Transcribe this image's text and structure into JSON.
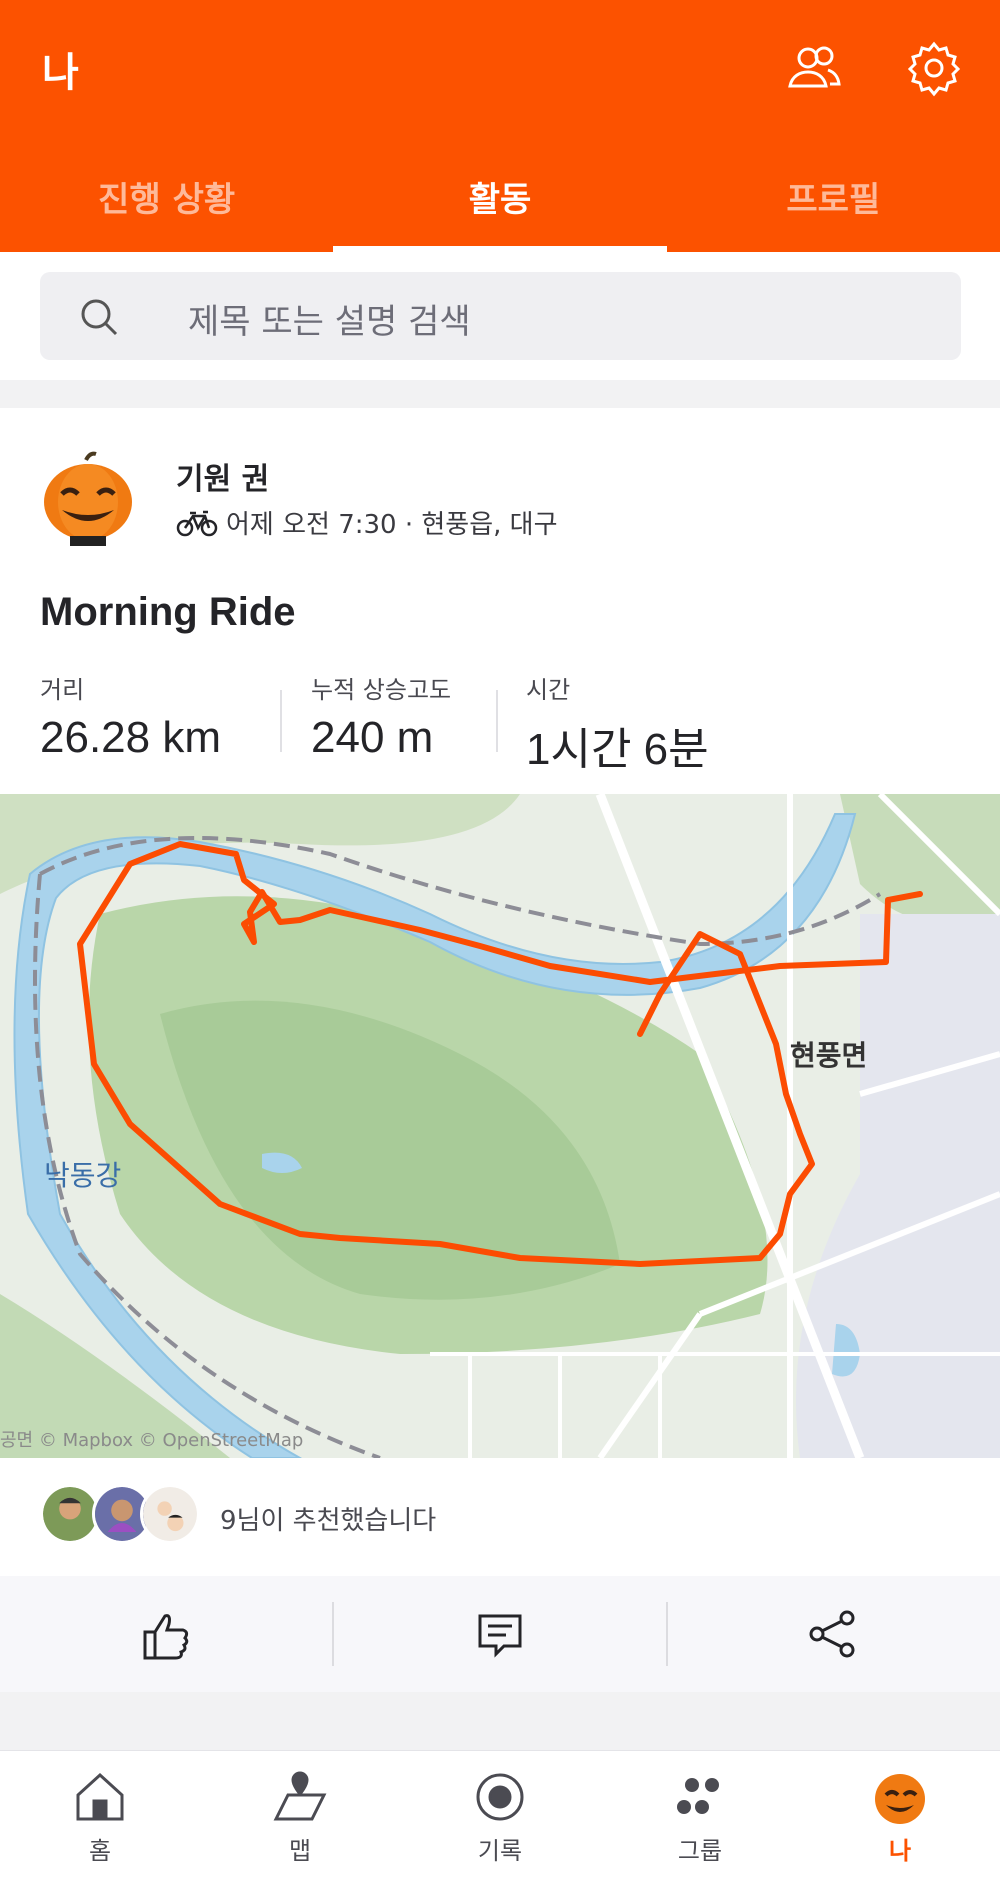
{
  "header": {
    "title": "나",
    "tabs": [
      {
        "label": "진행 상황"
      },
      {
        "label": "활동"
      },
      {
        "label": "프로필"
      }
    ]
  },
  "search": {
    "placeholder": "제목 또는 설명 검색"
  },
  "activity": {
    "athlete_name": "기원 권",
    "meta": "어제 오전 7:30 · 현풍읍, 대구",
    "title": "Morning Ride",
    "stats": [
      {
        "label": "거리",
        "value": "26.28 km"
      },
      {
        "label": "누적 상승고도",
        "value": "240 m"
      },
      {
        "label": "시간",
        "value": "1시간 6분"
      }
    ],
    "map": {
      "town_label": "현풍면",
      "river_label": "낙동강",
      "attribution": "공면 © Mapbox © OpenStreetMap",
      "route_color": "#fc4c02"
    },
    "kudos_text": "9님이 추천했습니다"
  },
  "nav": {
    "items": [
      {
        "label": "홈"
      },
      {
        "label": "맵"
      },
      {
        "label": "기록"
      },
      {
        "label": "그룹"
      },
      {
        "label": "나"
      }
    ]
  },
  "colors": {
    "brand": "#fc5200"
  }
}
